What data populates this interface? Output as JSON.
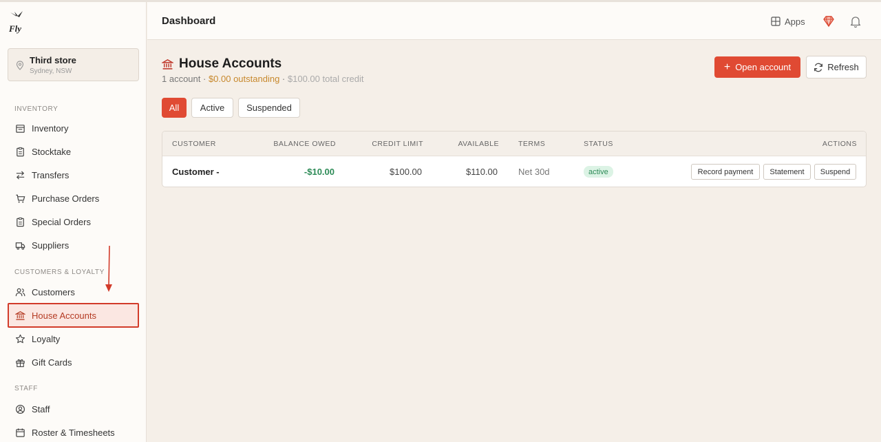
{
  "app": {
    "logo_text": "Fly"
  },
  "store": {
    "name": "Third store",
    "location": "Sydney, NSW"
  },
  "sidebar": {
    "sections": [
      {
        "label": "INVENTORY"
      },
      {
        "label": "CUSTOMERS & LOYALTY"
      },
      {
        "label": "STAFF"
      }
    ],
    "items": [
      {
        "label": "Inventory",
        "icon": "inventory-icon"
      },
      {
        "label": "Stocktake",
        "icon": "clipboard-icon"
      },
      {
        "label": "Transfers",
        "icon": "transfer-arrows-icon"
      },
      {
        "label": "Purchase Orders",
        "icon": "cart-icon"
      },
      {
        "label": "Special Orders",
        "icon": "clipboard-icon"
      },
      {
        "label": "Suppliers",
        "icon": "truck-icon"
      },
      {
        "label": "Customers",
        "icon": "users-icon"
      },
      {
        "label": "House Accounts",
        "icon": "bank-icon",
        "active": true
      },
      {
        "label": "Loyalty",
        "icon": "star-icon"
      },
      {
        "label": "Gift Cards",
        "icon": "gift-icon"
      },
      {
        "label": "Staff",
        "icon": "user-circle-icon"
      },
      {
        "label": "Roster & Timesheets",
        "icon": "calendar-icon"
      }
    ]
  },
  "header": {
    "title": "Dashboard",
    "apps_label": "Apps"
  },
  "page": {
    "title": "House Accounts",
    "summary_count": "1 account",
    "summary_sep": " · ",
    "summary_outstanding": "$0.00 outstanding",
    "summary_credit": "$100.00 total credit",
    "open_button": "Open account",
    "refresh_button": "Refresh"
  },
  "filters": [
    {
      "label": "All",
      "active": true
    },
    {
      "label": "Active",
      "active": false
    },
    {
      "label": "Suspended",
      "active": false
    }
  ],
  "table": {
    "columns": [
      "CUSTOMER",
      "BALANCE OWED",
      "CREDIT LIMIT",
      "AVAILABLE",
      "TERMS",
      "STATUS",
      "ACTIONS"
    ],
    "rows": [
      {
        "customer": "Customer -",
        "balance_owed": "-$10.00",
        "credit_limit": "$100.00",
        "available": "$110.00",
        "terms": "Net 30d",
        "status": "active",
        "actions": [
          "Record payment",
          "Statement",
          "Suspend"
        ]
      }
    ]
  },
  "colors": {
    "accent": "#e04a33",
    "positive": "#2d8b57",
    "outstanding": "#c7882c"
  }
}
